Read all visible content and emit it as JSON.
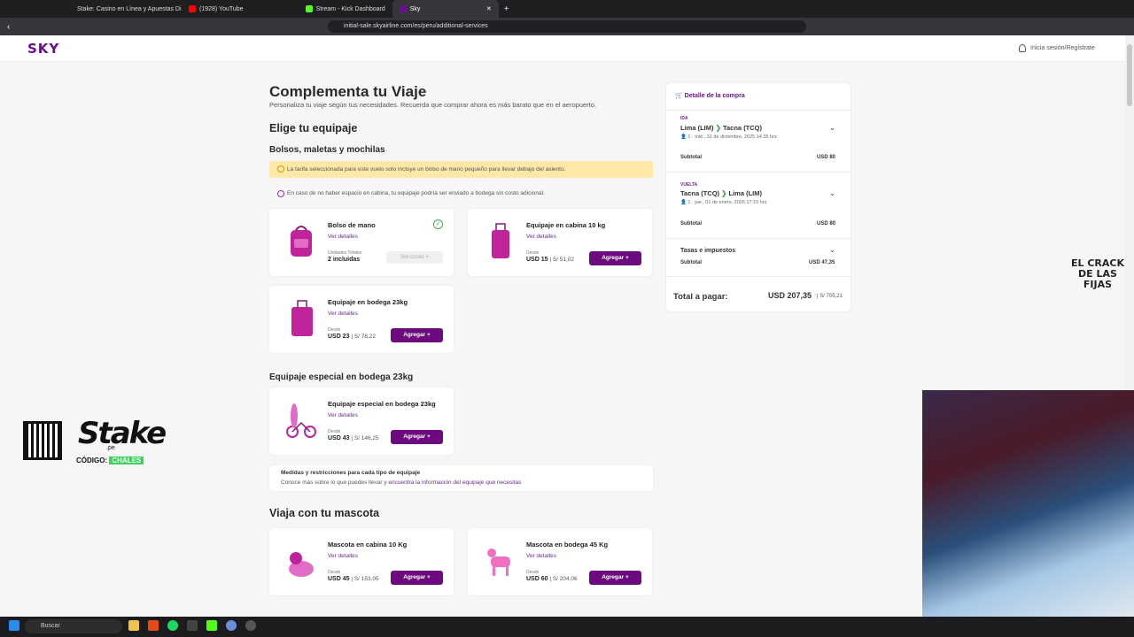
{
  "browser": {
    "tabs": [
      {
        "title": "Stake: Casino en Línea y Apuestas Di",
        "favicon_color": "#888888"
      },
      {
        "title": "(1928) YouTube",
        "favicon_color": "#ff0000"
      },
      {
        "title": "Stream - Kick Dashboard",
        "favicon_color": "#53fc18"
      },
      {
        "title": "Sky",
        "favicon_color": "#6b0f8f"
      }
    ],
    "url": "initial-sale.skyairline.com/es/peru/additional-services"
  },
  "header": {
    "logo": "SKY",
    "login": "Inicia sesión/Regístrate"
  },
  "page": {
    "title": "Complementa tu Viaje",
    "subtitle": "Personaliza tu viaje según tus necesidades. Recuerda que comprar ahora es más barato que en el aeropuerto.",
    "luggage_title": "Elige tu equipaje",
    "bags_title": "Bolsos, maletas y mochilas",
    "banner": "La tarifa seleccionada para este vuelo solo incluye un bolso de mano pequeño para llevar debajo del asiento.",
    "note": "En caso de no haber espacio en cabina, tu equipaje podría ser enviado a bodega sin costo adicional.",
    "special_title": "Equipaje especial en bodega 23kg",
    "pet_title": "Viaja con tu mascota",
    "measures_title": "Medidas y restricciones para cada tipo de equipaje",
    "measures_text": "Conoce más sobre lo que puedes llevar y",
    "measures_link": "encuentra la información del equipaje que necesitas"
  },
  "cards": {
    "hand": {
      "title": "Bolso de mano",
      "details": "Ver detalles",
      "units_label": "Unidades Totales",
      "units": "2 incluidas",
      "action": "Sin costo  +"
    },
    "cabin": {
      "title": "Equipaje en cabina 10 kg",
      "details": "Ver detalles",
      "from": "Desde",
      "price": "USD 15",
      "local": " | S/ 51,02",
      "action": "Agregar  +"
    },
    "hold": {
      "title": "Equipaje en bodega 23kg",
      "details": "Ver detalles",
      "from": "Desde",
      "price": "USD 23",
      "local": " | S/ 78,22",
      "action": "Agregar  +"
    },
    "special": {
      "title": "Equipaje especial en bodega 23kg",
      "details": "Ver detalles",
      "from": "Desde",
      "price": "USD 43",
      "local": " | S/ 146,25",
      "action": "Agregar  +"
    },
    "pet_cabin": {
      "title": "Mascota en cabina 10 Kg",
      "details": "Ver detalles",
      "from": "Desde",
      "price": "USD 45",
      "local": " | S/ 153,05",
      "action": "Agregar  +"
    },
    "pet_hold": {
      "title": "Mascota en bodega 45 Kg",
      "details": "Ver detalles",
      "from": "Desde",
      "price": "USD 60",
      "local": " | S/ 204,06",
      "action": "Agregar  +"
    }
  },
  "summary": {
    "title": "Detalle de la compra",
    "outbound": {
      "label": "IDA",
      "from": "Lima (LIM)",
      "to": "Tacna (TCQ)",
      "pax": "1",
      "date": "mié., 31 de diciembre, 2025 14:35 hrs",
      "subtotal_label": "Subtotal",
      "subtotal": "USD 80"
    },
    "return": {
      "label": "VUELTA",
      "from": "Tacna (TCQ)",
      "to": "Lima (LIM)",
      "pax": "1",
      "date": "jue., 01 de enero, 2026 17:15 hrs",
      "subtotal_label": "Subtotal",
      "subtotal": "USD 80"
    },
    "taxes": {
      "label": "Tasas e impuestos",
      "subtotal_label": "Subtotal",
      "subtotal": "USD 47,35"
    },
    "total_label": "Total a pagar:",
    "total": "USD 207,35",
    "total_local": "| S/ 705,21"
  },
  "overlay": {
    "sponsor": "Stake",
    "sponsor_sub": ".pe",
    "code_label": "CÓDIGO:",
    "code": "CHALES",
    "badge": "EL CRACK DE LAS FIJAS"
  },
  "taskbar": {
    "search": "Buscar"
  }
}
